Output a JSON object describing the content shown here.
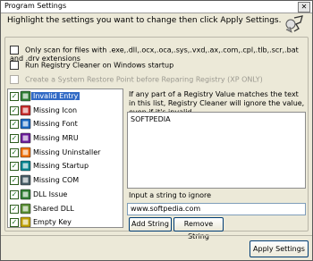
{
  "window": {
    "title": "Program Settings",
    "close_glyph": "✕"
  },
  "heading": "Highlight the settings you want to change then click Apply Settings.",
  "options": [
    {
      "label": "Only scan for files with .exe,.dll,.ocx,.oca,.sys,.vxd,.ax,.com,.cpl,.tlb,.scr,.bat and .drv extensions",
      "checked": false,
      "enabled": true
    },
    {
      "label": "Run Registry Cleaner on Windows startup",
      "checked": false,
      "enabled": true
    },
    {
      "label": "Create a System Restore Point before Reparing Registry (XP ONLY)",
      "checked": false,
      "enabled": false
    }
  ],
  "scan_items": [
    {
      "label": "Invalid Entry",
      "checked": true,
      "selected": true,
      "icon": "invalid-entry-icon",
      "color": "#2e7d32"
    },
    {
      "label": "Missing Icon",
      "checked": true,
      "selected": false,
      "icon": "missing-icon-icon",
      "color": "#c62828"
    },
    {
      "label": "Missing Font",
      "checked": true,
      "selected": false,
      "icon": "missing-font-icon",
      "color": "#1565c0"
    },
    {
      "label": "Missing MRU",
      "checked": true,
      "selected": false,
      "icon": "missing-mru-icon",
      "color": "#6a1b9a"
    },
    {
      "label": "Missing Uninstaller",
      "checked": true,
      "selected": false,
      "icon": "missing-uninstaller-icon",
      "color": "#ef6c00"
    },
    {
      "label": "Missing Startup",
      "checked": true,
      "selected": false,
      "icon": "missing-startup-icon",
      "color": "#00838f"
    },
    {
      "label": "Missing COM",
      "checked": true,
      "selected": false,
      "icon": "missing-com-icon",
      "color": "#455a64"
    },
    {
      "label": "DLL Issue",
      "checked": true,
      "selected": false,
      "icon": "dll-issue-icon",
      "color": "#2e7d32"
    },
    {
      "label": "Shared DLL",
      "checked": true,
      "selected": false,
      "icon": "shared-dll-icon",
      "color": "#558b2f"
    },
    {
      "label": "Empty Key",
      "checked": true,
      "selected": false,
      "icon": "empty-key-icon",
      "color": "#c0a000"
    }
  ],
  "ignore": {
    "description": "If any part of a Registry Value matches the text in this list, Registry Cleaner will ignore the value, even if it's invalid.",
    "list": [
      "SOFTPEDIA"
    ],
    "input_label": "Input a string to ignore",
    "input_value": "www.softpedia.com",
    "add_button": "Add String",
    "remove_button": "Remove String"
  },
  "apply_button": "Apply Settings"
}
